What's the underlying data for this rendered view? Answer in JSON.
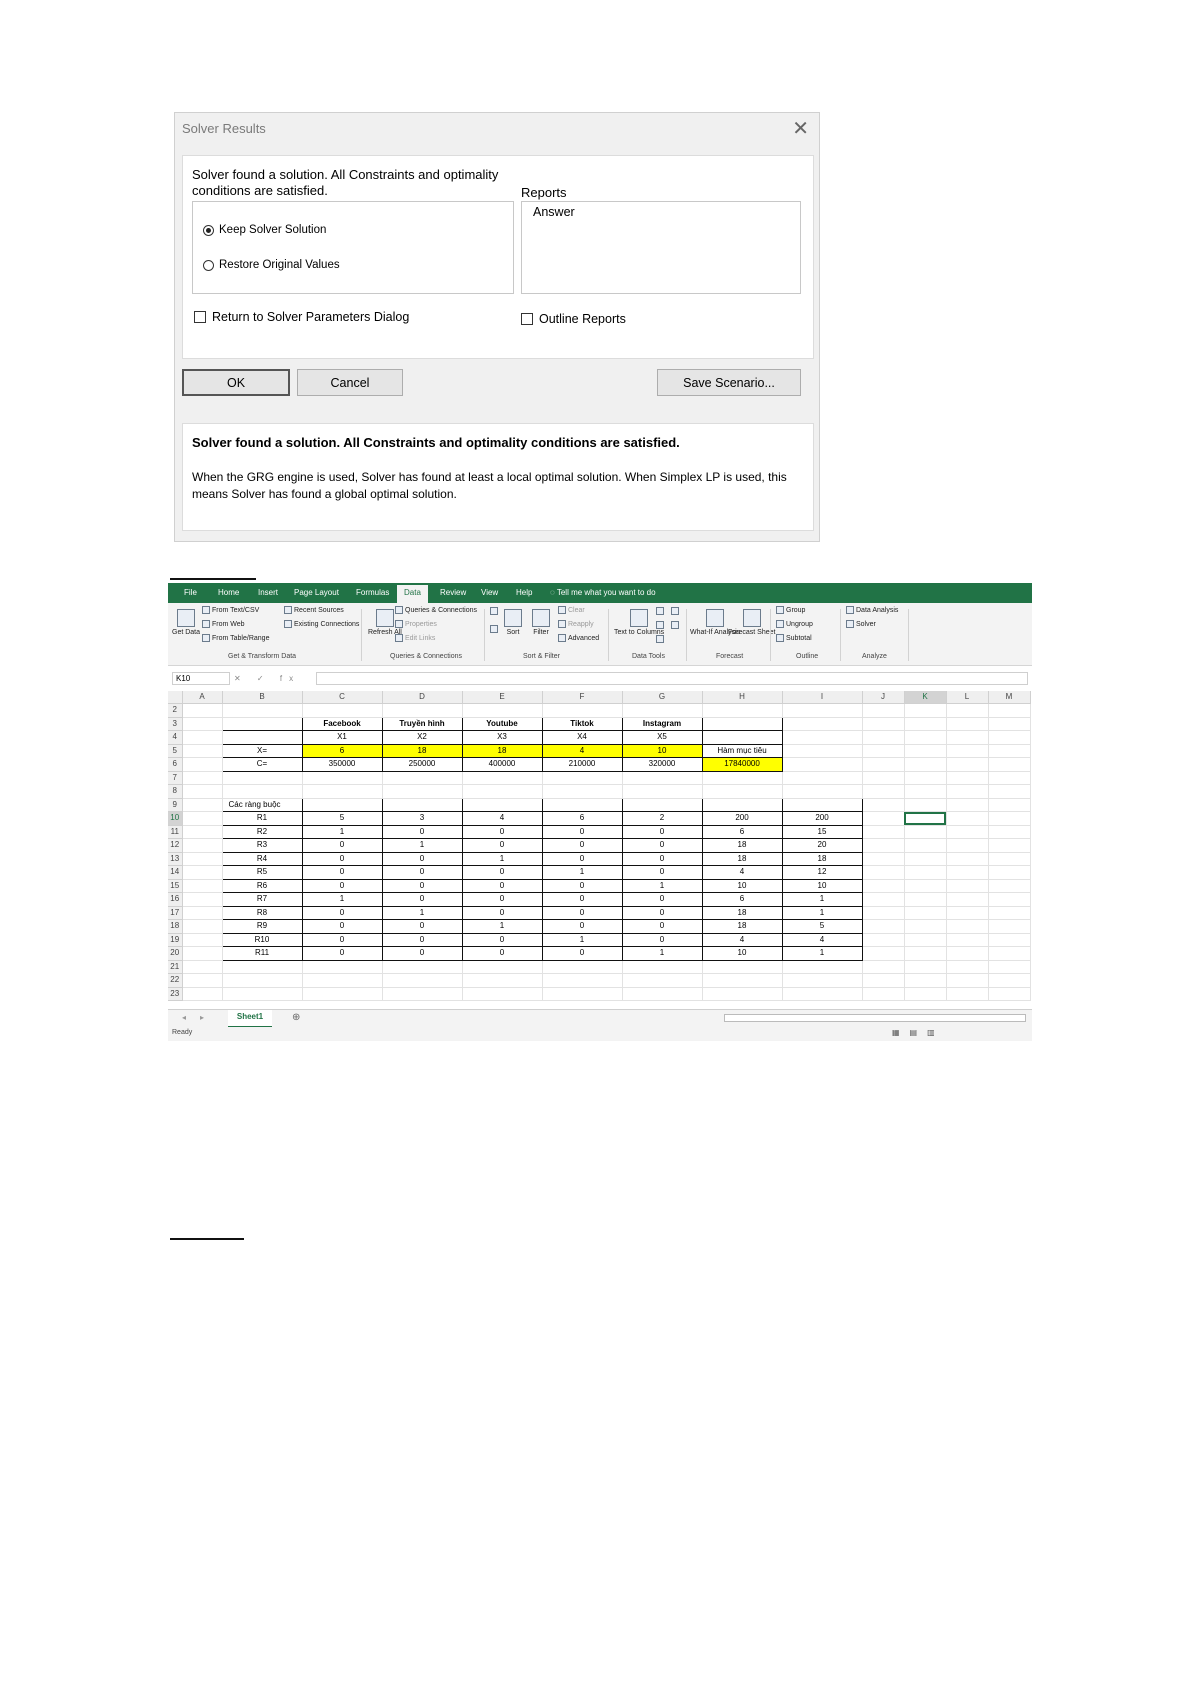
{
  "dialog": {
    "title": "Solver Results",
    "close": "✕",
    "found_text": "Solver found a solution.  All Constraints and optimality conditions are satisfied.",
    "options": [
      {
        "label": "Keep Solver Solution",
        "selected": true
      },
      {
        "label": "Restore Original Values",
        "selected": false
      }
    ],
    "reports_label": "Reports",
    "reports": [
      "Answer"
    ],
    "return_checkbox": "Return to Solver Parameters Dialog",
    "outline_checkbox": "Outline Reports",
    "buttons": {
      "ok": "OK",
      "cancel": "Cancel",
      "save": "Save Scenario..."
    },
    "summary_bold": "Solver found a solution.  All Constraints and optimality conditions are satisfied.",
    "summary_detail": "When the GRG engine is used, Solver has found at least a local optimal solution. When Simplex LP is used, this means Solver has found a global optimal solution."
  },
  "excel": {
    "tabs": [
      "File",
      "Home",
      "Insert",
      "Page Layout",
      "Formulas",
      "Data",
      "Review",
      "View",
      "Help"
    ],
    "active_tab": "Data",
    "tell_me": "Tell me what you want to do",
    "ribbon": {
      "get_data": "Get Data",
      "from_text_csv": "From Text/CSV",
      "from_web": "From Web",
      "from_table_range": "From Table/Range",
      "recent_sources": "Recent Sources",
      "existing_connections": "Existing Connections",
      "refresh_all": "Refresh All",
      "queries_connections": "Queries & Connections",
      "properties": "Properties",
      "edit_links": "Edit Links",
      "sort": "Sort",
      "filter": "Filter",
      "clear": "Clear",
      "reapply": "Reapply",
      "advanced": "Advanced",
      "text_to_columns": "Text to Columns",
      "what_if": "What-If Analysis",
      "forecast_sheet": "Forecast Sheet",
      "group": "Group",
      "ungroup": "Ungroup",
      "subtotal": "Subtotal",
      "data_analysis": "Data Analysis",
      "solver": "Solver",
      "groups": {
        "get_transform": "Get & Transform Data",
        "queries": "Queries & Connections",
        "sort_filter": "Sort & Filter",
        "data_tools": "Data Tools",
        "forecast": "Forecast",
        "outline": "Outline",
        "analyze": "Analyze"
      }
    },
    "name_box": "K10",
    "fx": "✕ ✓ fx",
    "columns": [
      "A",
      "B",
      "C",
      "D",
      "E",
      "F",
      "G",
      "H",
      "I",
      "J",
      "K",
      "L",
      "M"
    ],
    "cells": {
      "C3": "Facebook",
      "D3": "Truyền hình",
      "E3": "Youtube",
      "F3": "Tiktok",
      "G3": "Instagram",
      "C4": "X1",
      "D4": "X2",
      "E4": "X3",
      "F4": "X4",
      "G4": "X5",
      "B5": "X=",
      "C5": "6",
      "D5": "18",
      "E5": "18",
      "F5": "4",
      "G5": "10",
      "H5": "Hàm mục tiêu",
      "B6": "C=",
      "C6": "350000",
      "D6": "250000",
      "E6": "400000",
      "F6": "210000",
      "G6": "320000",
      "H6": "17840000",
      "B9": "Các ràng buộc",
      "B10": "R1",
      "C10": "5",
      "D10": "3",
      "E10": "4",
      "F10": "6",
      "G10": "2",
      "H10": "200",
      "I10": "200",
      "B11": "R2",
      "C11": "1",
      "D11": "0",
      "E11": "0",
      "F11": "0",
      "G11": "0",
      "H11": "6",
      "I11": "15",
      "B12": "R3",
      "C12": "0",
      "D12": "1",
      "E12": "0",
      "F12": "0",
      "G12": "0",
      "H12": "18",
      "I12": "20",
      "B13": "R4",
      "C13": "0",
      "D13": "0",
      "E13": "1",
      "F13": "0",
      "G13": "0",
      "H13": "18",
      "I13": "18",
      "B14": "R5",
      "C14": "0",
      "D14": "0",
      "E14": "0",
      "F14": "1",
      "G14": "0",
      "H14": "4",
      "I14": "12",
      "B15": "R6",
      "C15": "0",
      "D15": "0",
      "E15": "0",
      "F15": "0",
      "G15": "1",
      "H15": "10",
      "I15": "10",
      "B16": "R7",
      "C16": "1",
      "D16": "0",
      "E16": "0",
      "F16": "0",
      "G16": "0",
      "H16": "6",
      "I16": "1",
      "B17": "R8",
      "C17": "0",
      "D17": "1",
      "E17": "0",
      "F17": "0",
      "G17": "0",
      "H17": "18",
      "I17": "1",
      "B18": "R9",
      "C18": "0",
      "D18": "0",
      "E18": "1",
      "F18": "0",
      "G18": "0",
      "H18": "18",
      "I18": "5",
      "B19": "R10",
      "C19": "0",
      "D19": "0",
      "E19": "0",
      "F19": "1",
      "G19": "0",
      "H19": "4",
      "I19": "4",
      "B20": "R11",
      "C20": "0",
      "D20": "0",
      "E20": "0",
      "F20": "0",
      "G20": "1",
      "H20": "10",
      "I20": "1"
    },
    "sheet_tab": "Sheet1",
    "add_sheet": "⊕",
    "status": "Ready",
    "colors": {
      "accent": "#217346",
      "highlight": "#ffff00"
    }
  }
}
